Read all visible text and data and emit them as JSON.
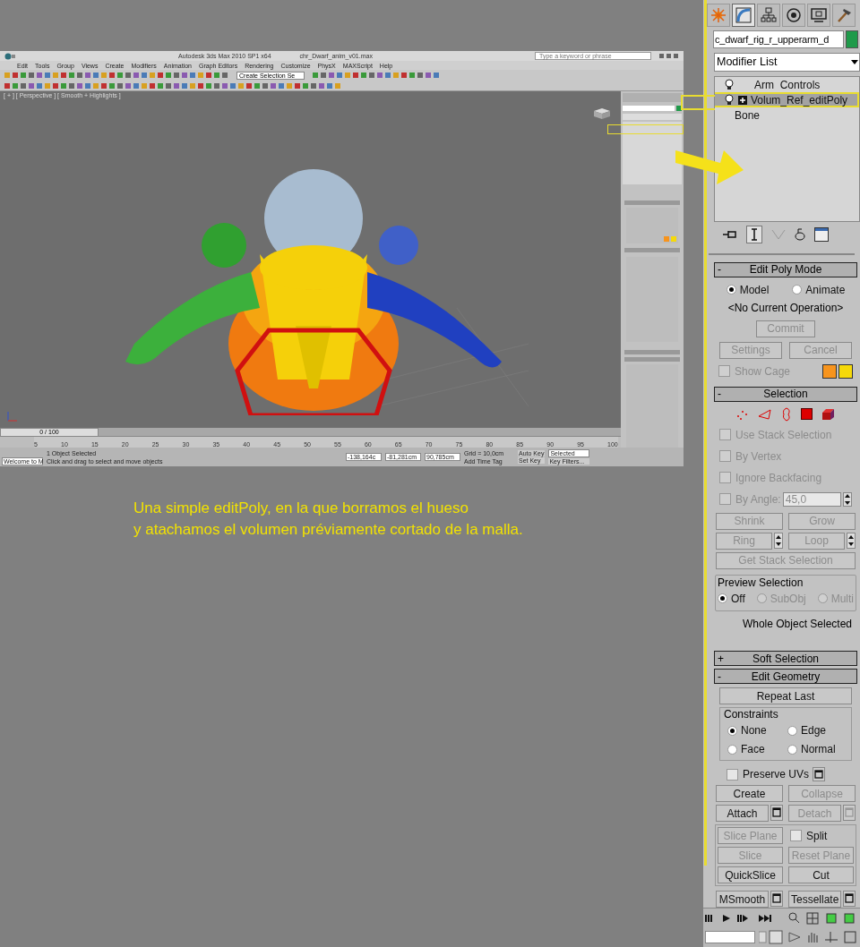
{
  "screenshot": {
    "title": "Autodesk 3ds Max 2010 SP1 x64",
    "file": "chr_Dwarf_anim_v01.max",
    "search_placeholder": "Type a keyword or phrase",
    "menu": [
      "Edit",
      "Tools",
      "Group",
      "Views",
      "Create",
      "Modifiers",
      "Animation",
      "Graph Editors",
      "Rendering",
      "Customize",
      "PhysX",
      "MAXScript",
      "Help"
    ],
    "selection_set": "Create Selection Se",
    "viewport_label": "[ + ] [ Perspective ] [ Smooth + Highlights ]",
    "time_position": "0 / 100",
    "ticks": [
      "5",
      "10",
      "15",
      "20",
      "25",
      "30",
      "35",
      "40",
      "45",
      "50",
      "55",
      "60",
      "65",
      "70",
      "75",
      "80",
      "85",
      "90",
      "95",
      "100"
    ],
    "status": "1 Object Selected",
    "prompt": "Click and drag to select and move objects",
    "listener": "Welcome to M",
    "x": "-138,164c",
    "y": "-81,281cm",
    "z": "90,785cm",
    "grid": "Grid = 10,0cm",
    "auto_key": "Auto Key",
    "key_mode": "Selected",
    "set_key": "Set Key",
    "key_filters": "Key Filters...",
    "add_time_tag": "Add Time Tag"
  },
  "caption": [
    "Una simple editPoly, en la que borramos el hueso",
    "y atachamos el volumen préviamente cortado de la malla."
  ],
  "panel": {
    "tabs": [
      {
        "selected": false
      },
      {
        "selected": true
      },
      {
        "selected": false
      },
      {
        "selected": false
      },
      {
        "selected": false
      },
      {
        "selected": false
      }
    ],
    "object_name": "c_dwarf_rig_r_upperarm_d",
    "modifier_list": "Modifier List",
    "stack": [
      {
        "kind": "modifier",
        "label": "Arm  Controls",
        "selected": false
      },
      {
        "kind": "group",
        "label": "Volum_Ref_editPoly",
        "selected": true
      },
      {
        "kind": "base",
        "label": "Bone",
        "selected": false
      }
    ],
    "edit_poly_mode": {
      "sign": "-",
      "title": "Edit Poly Mode",
      "modes": [
        {
          "label": "Model",
          "selected": true
        },
        {
          "label": "Animate",
          "selected": false
        }
      ],
      "operation": "<No Current Operation>",
      "commit": {
        "label": "Commit",
        "disabled": true
      },
      "buttons": [
        {
          "kind": "button",
          "label": "Settings",
          "disabled": true
        },
        {
          "kind": "button",
          "label": "Cancel",
          "disabled": true
        }
      ],
      "show_cage": {
        "label": "Show Cage",
        "checked": false,
        "disabled": true
      }
    },
    "selection": {
      "sign": "-",
      "title": "Selection",
      "checks": [
        {
          "label": "Use Stack Selection",
          "checked": false,
          "disabled": true
        },
        {
          "label": "By Vertex",
          "checked": false,
          "disabled": true
        },
        {
          "label": "Ignore Backfacing",
          "checked": false,
          "disabled": true
        }
      ],
      "by_angle": {
        "label": "By Angle:",
        "value": "45,0",
        "checked": false,
        "disabled": true
      },
      "buttons": [
        {
          "kind": "button",
          "label": "Shrink",
          "disabled": true
        },
        {
          "kind": "button",
          "label": "Grow",
          "disabled": true
        },
        {
          "kind": "spinner_button",
          "label": "Ring",
          "disabled": true
        },
        {
          "kind": "spinner_button",
          "label": "Loop",
          "disabled": true
        },
        {
          "kind": "wide_button",
          "label": "Get Stack Selection",
          "disabled": true
        }
      ],
      "preview": {
        "title": "Preview Selection",
        "options": [
          {
            "label": "Off",
            "selected": true,
            "disabled": false
          },
          {
            "label": "SubObj",
            "selected": false,
            "disabled": true
          },
          {
            "label": "Multi",
            "selected": false,
            "disabled": true
          }
        ]
      },
      "info": "Whole Object Selected"
    },
    "soft_selection": {
      "sign": "+",
      "title": "Soft Selection"
    },
    "edit_geometry": {
      "sign": "-",
      "title": "Edit Geometry",
      "repeat_last": {
        "label": "Repeat Last",
        "disabled": false
      },
      "constraints": {
        "title": "Constraints",
        "options": [
          {
            "label": "None",
            "selected": true
          },
          {
            "label": "Edge",
            "selected": false
          },
          {
            "label": "Face",
            "selected": false
          },
          {
            "label": "Normal",
            "selected": false
          }
        ]
      },
      "preserve_uvs": {
        "label": "Preserve UVs",
        "checked": false,
        "disabled": false
      },
      "buttons": [
        {
          "kind": "button",
          "label": "Create",
          "disabled": false
        },
        {
          "kind": "button",
          "label": "Collapse",
          "disabled": true
        },
        {
          "kind": "settings_button",
          "label": "Attach",
          "disabled": false
        },
        {
          "kind": "settings_button",
          "label": "Detach",
          "disabled": true
        }
      ],
      "slice_buttons": [
        {
          "kind": "button",
          "label": "Slice Plane",
          "disabled": true
        },
        {
          "kind": "checkbox",
          "label": "Split",
          "checked": false,
          "disabled": false
        },
        {
          "kind": "button",
          "label": "Slice",
          "disabled": true
        },
        {
          "kind": "button",
          "label": "Reset Plane",
          "disabled": true
        },
        {
          "kind": "button",
          "label": "QuickSlice",
          "disabled": false
        },
        {
          "kind": "button",
          "label": "Cut",
          "disabled": false
        }
      ],
      "more_buttons": [
        {
          "kind": "settings_button",
          "label": "MSmooth",
          "disabled": false
        },
        {
          "kind": "settings_button",
          "label": "Tessellate",
          "disabled": false
        }
      ]
    }
  }
}
